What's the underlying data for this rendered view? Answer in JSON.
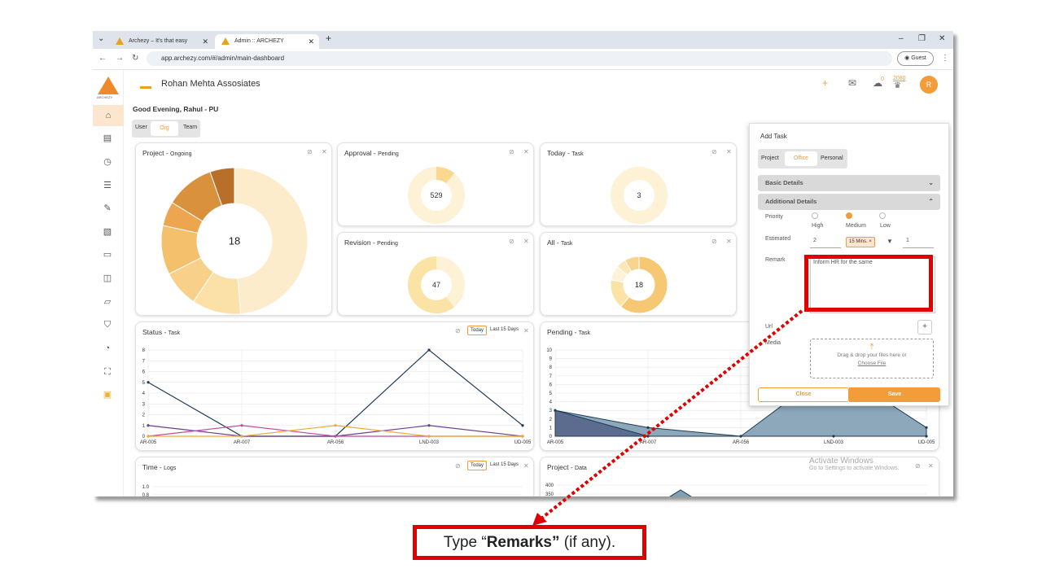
{
  "browser": {
    "tabs": [
      {
        "title": "Archezy – It's that easy",
        "close": "✕"
      },
      {
        "title": "Admin :: ARCHEZY",
        "close": "✕"
      }
    ],
    "tab_menu": "⌄",
    "new_tab": "+",
    "url": "app.archezy.com/#/admin/main-dashboard",
    "guest_label": "Guest",
    "window": {
      "minimize": "–",
      "restore": "❐",
      "close": "✕"
    },
    "menu": "⋮"
  },
  "app": {
    "logo_text": "ARCHEZY",
    "company": "Rohan Mehta Assosiates",
    "greeting": "Good Evening, Rahul - PU",
    "scope_tabs": [
      "User",
      "Org",
      "Team"
    ],
    "selected_scope": "Org",
    "notif_count": "0",
    "points": "2080",
    "avatar": "R"
  },
  "cards": {
    "project": {
      "title": "Project - ",
      "sub": "Ongoing",
      "center": "18"
    },
    "approval": {
      "title": "Approval - ",
      "sub": "Pending",
      "center": "529"
    },
    "today": {
      "title": "Today - ",
      "sub": "Task",
      "center": "3"
    },
    "revision": {
      "title": "Revision - ",
      "sub": "Pending",
      "center": "47"
    },
    "all": {
      "title": "All - ",
      "sub": "Task",
      "center": "18"
    },
    "status": {
      "title": "Status - ",
      "sub": "Task",
      "today": "Today",
      "last15": "Last 15 Days"
    },
    "pending": {
      "title": "Pending - ",
      "sub": "Task"
    },
    "time": {
      "title": "Time - ",
      "sub": "Logs",
      "today": "Today",
      "last15": "Last 15 Days"
    },
    "projdata": {
      "title": "Project - ",
      "sub": "Data"
    }
  },
  "chart_data": [
    {
      "type": "pie",
      "title": "Project - Ongoing",
      "center_label": "18",
      "values": [
        9,
        2,
        1.5,
        2,
        1,
        2,
        1
      ],
      "colors": [
        "#fdeccb",
        "#fbe0a8",
        "#f8d08a",
        "#f5c06c",
        "#eda64f",
        "#d9913e",
        "#b86f2a"
      ]
    },
    {
      "type": "pie",
      "title": "All - Task",
      "center_label": "18",
      "values": [
        11,
        3,
        1.5,
        1,
        1.5
      ],
      "colors": [
        "#f6c874",
        "#fbe3a6",
        "#fef3d6",
        "#fbe7b8",
        "#f8d58e"
      ]
    },
    {
      "type": "line",
      "title": "Status - Task",
      "categories": [
        "AR-005",
        "AR-007",
        "AR-056",
        "LND-003",
        "UD-005"
      ],
      "ylim": [
        0,
        8
      ],
      "yticks": [
        0,
        1,
        2,
        3,
        4,
        5,
        6,
        7,
        8
      ],
      "series": [
        {
          "values": [
            5,
            0,
            0,
            8,
            1
          ],
          "color": "#1f3b57"
        },
        {
          "values": [
            1,
            0,
            0,
            1,
            0
          ],
          "color": "#6a3d8f"
        },
        {
          "values": [
            0,
            1,
            0,
            0,
            0
          ],
          "color": "#c04aa0"
        },
        {
          "values": [
            0,
            0,
            1,
            0,
            0
          ],
          "color": "#f0a830"
        }
      ]
    },
    {
      "type": "area",
      "title": "Pending - Task",
      "categories": [
        "AR-005",
        "AR-007",
        "AR-056",
        "LND-003",
        "UD-005"
      ],
      "ylim": [
        0,
        10
      ],
      "yticks": [
        0,
        1,
        2,
        3,
        4,
        5,
        6,
        7,
        8,
        9,
        10
      ],
      "series": [
        {
          "values": [
            3,
            1,
            0,
            8,
            1
          ],
          "color": "#7f9fb2"
        },
        {
          "values": [
            3,
            0,
            0,
            0,
            0
          ],
          "color": "#56658a"
        }
      ]
    },
    {
      "type": "line",
      "title": "Time - Logs",
      "yticks_visible": [
        "1.0",
        "0.8"
      ]
    },
    {
      "type": "area",
      "title": "Project - Data",
      "yticks_visible": [
        "400",
        "350"
      ]
    }
  ],
  "add_task": {
    "title": "Add Task",
    "type_tabs": [
      "Project",
      "Office",
      "Personal"
    ],
    "selected_type": "Office",
    "basic_details": "Basic Details",
    "additional_details": "Additional Details",
    "priority_label": "Priority",
    "priorities": [
      "High",
      "Medium",
      "Low"
    ],
    "selected_priority": "Medium",
    "estimated_label": "Estimated",
    "estimated_value": "2",
    "estimated_unit": "15 Mins.",
    "estimated_count": "1",
    "remark_label": "Remark",
    "remark_value": "Inform HR for the same",
    "url_label": "Url",
    "media_label": "Media",
    "drop_text": "Drag & drop your files here or",
    "choose_file": "Choose File",
    "close_btn": "Close",
    "save_btn": "Save"
  },
  "watermark": {
    "line1": "Activate Windows",
    "line2": "Go to Settings to activate Windows."
  },
  "callout": {
    "prefix": "Type “",
    "bold": "Remarks”",
    "suffix": " (if any)."
  },
  "accent": "#f39c3a",
  "highlight_color": "#e00000"
}
